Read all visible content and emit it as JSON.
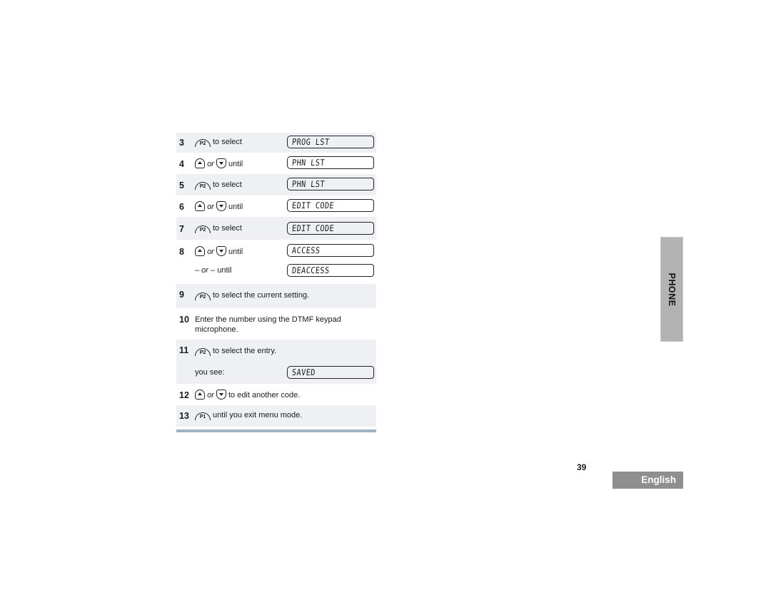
{
  "steps": [
    {
      "num": "3",
      "button": "P2",
      "text": "to select",
      "display": "PROG LST",
      "shaded": true
    },
    {
      "num": "4",
      "button": "up-down",
      "or": "or",
      "text": "until",
      "display": "PHN LST",
      "shaded": false
    },
    {
      "num": "5",
      "button": "P2",
      "text": "to select",
      "display": "PHN LST",
      "shaded": true
    },
    {
      "num": "6",
      "button": "up-down",
      "or": "or",
      "text": "until",
      "display": "EDIT CODE",
      "shaded": false
    },
    {
      "num": "7",
      "button": "P2",
      "text": "to select",
      "display": "EDIT CODE",
      "shaded": true
    },
    {
      "num": "8",
      "button": "up-down",
      "or": "or",
      "text": "until",
      "display": "ACCESS",
      "shaded": false
    },
    {
      "num": "",
      "or_prefix": "– or –",
      "text": "until",
      "display": "DEACCESS",
      "shaded": false
    },
    {
      "num": "9",
      "button": "P2",
      "text": "to select the current setting.",
      "shaded": true
    },
    {
      "num": "10",
      "text": "Enter the number using the DTMF keypad",
      "text2": "microphone.",
      "shaded": false
    },
    {
      "num": "11",
      "button": "P2",
      "text": "to select the entry.",
      "shaded": true
    },
    {
      "num": "",
      "text": "you see:",
      "display": "SAVED",
      "shaded": true
    },
    {
      "num": "12",
      "button": "up-down",
      "or": "or",
      "text": "to edit another code.",
      "shaded": false
    },
    {
      "num": "13",
      "button": "P1",
      "text": "until you exit menu mode.",
      "shaded": true
    }
  ],
  "side_tab": {
    "label": "PHONE"
  },
  "footer": {
    "page_number": "39",
    "language": "English"
  },
  "colors": {
    "shaded_row": "#eef0f4",
    "bottom_bar": "#9fb3c3",
    "side_tab": "#b3b3b3",
    "language_tab": "#8f8f8f"
  }
}
